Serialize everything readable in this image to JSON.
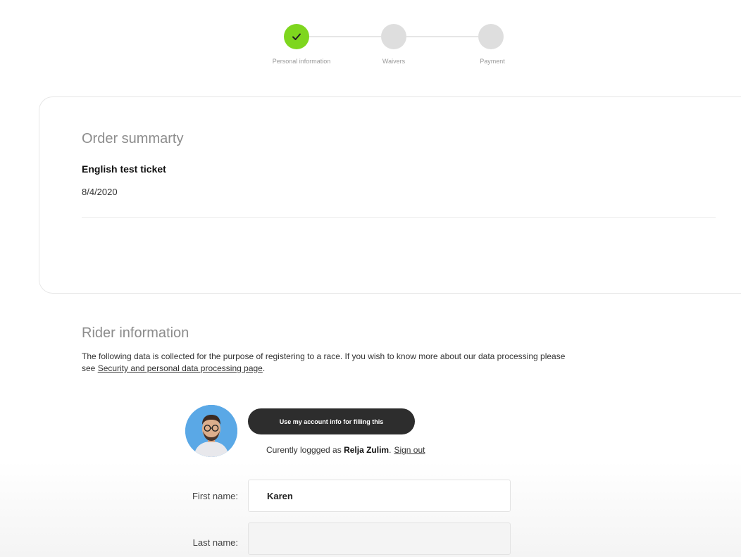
{
  "stepper": {
    "steps": [
      {
        "label": "Personal information",
        "status": "completed",
        "icon": "check-icon"
      },
      {
        "label": "Waivers",
        "status": "pending"
      },
      {
        "label": "Payment",
        "status": "pending"
      }
    ],
    "completed_color": "#7ed61e",
    "pending_color": "#dedede"
  },
  "order_summary": {
    "title": "Order summarty",
    "ticket_name": "English test ticket",
    "date": "8/4/2020"
  },
  "rider_information": {
    "title": "Rider information",
    "description_before_link": "The following data is collected for the purpose of registering to a race. If you wish to know more about our data processing please see ",
    "link_text": "Security and personal data processing page",
    "description_after_link": ".",
    "account_button_label": "Use my account info for filling this",
    "logged_prefix": "Curently loggged as ",
    "logged_user": "Relja Zulim",
    "logged_separator": ".",
    "sign_out_label": "Sign out",
    "avatar_icon": "user-avatar",
    "fields": {
      "first_name_label": "First name:",
      "first_name_value": "Karen",
      "last_name_label": "Last name:",
      "last_name_value": ""
    }
  }
}
